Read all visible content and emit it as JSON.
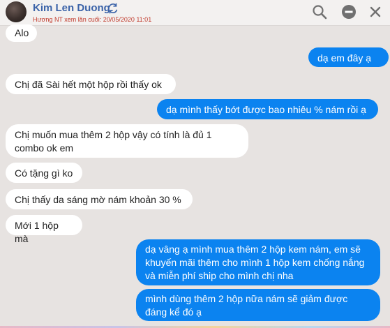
{
  "header": {
    "name": "Kim Len Duong",
    "seen_text": "Hương NT xem lần cuối: 20/05/2020 11:01",
    "icons": [
      "refresh-icon",
      "search-icon",
      "minus-icon",
      "close-icon"
    ]
  },
  "messages": [
    {
      "dir": "in",
      "text": "Alo"
    },
    {
      "dir": "out",
      "text": "dạ em đây ạ"
    },
    {
      "dir": "in",
      "text": "Chị đã Sài hết một hộp rồi thấy ok"
    },
    {
      "dir": "out",
      "text": "dạ mình thấy bớt được bao nhiêu % nám rồi ạ"
    },
    {
      "dir": "in",
      "text": "Chị muốn mua thêm 2 hộp vậy có tính là đủ 1 combo ok em"
    },
    {
      "dir": "in",
      "text": "Có tặng gì ko"
    },
    {
      "dir": "in",
      "text": "Chị thấy da sáng mờ nám khoản 30 %"
    },
    {
      "dir": "in",
      "text": "Mới 1 hộp mà"
    },
    {
      "dir": "out",
      "text": "dạ vâng ạ mình mua thêm 2 hộp kem nám, em sẽ khuyến mãi thêm cho mình 1 hộp kem chống nắng và miễn phí ship cho mình chị nha"
    },
    {
      "dir": "out",
      "text": "mình dùng thêm 2 hộp nữa nám sẽ giảm được đáng kể đó ạ"
    }
  ],
  "colors": {
    "incoming_bg": "#ffffff",
    "outgoing_bg": "#0b83f0",
    "name": "#3b63a8",
    "seen": "#c0392b"
  }
}
